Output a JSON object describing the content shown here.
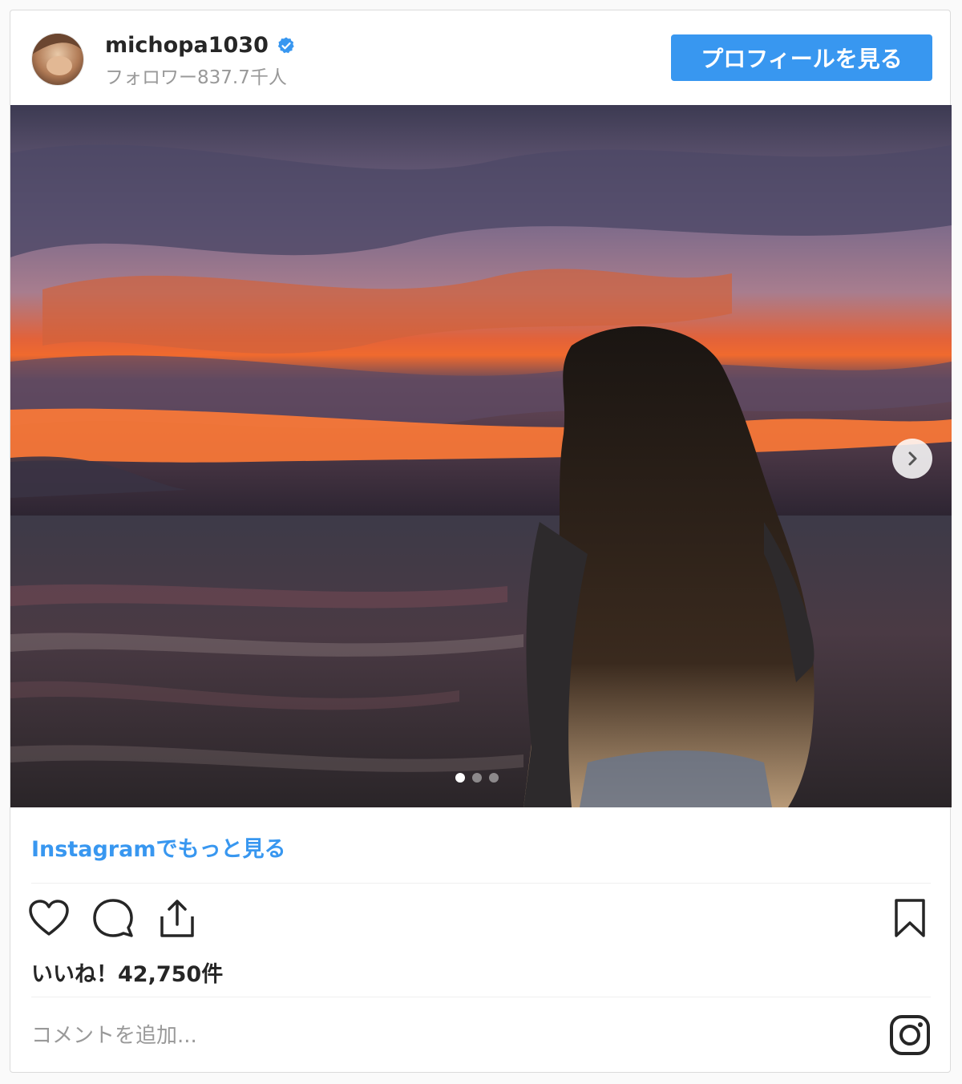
{
  "post": {
    "username": "michopa1030",
    "followers": "フォロワー837.7千人",
    "profile_button": "プロフィールを見る",
    "more_link": "Instagramでもっと見る",
    "likes": "いいね！42,750件",
    "comment_placeholder": "コメントを追加...",
    "carousel": {
      "total": 3,
      "current": 1
    }
  },
  "icons": {
    "verified": "verified-badge-icon",
    "like": "heart-icon",
    "comment": "comment-bubble-icon",
    "share": "share-icon",
    "save": "bookmark-icon",
    "next": "chevron-right-icon",
    "brand": "instagram-logo-icon"
  },
  "colors": {
    "accent": "#3897f0",
    "text": "#262626",
    "muted": "#999999",
    "border": "#dbdbdb"
  }
}
